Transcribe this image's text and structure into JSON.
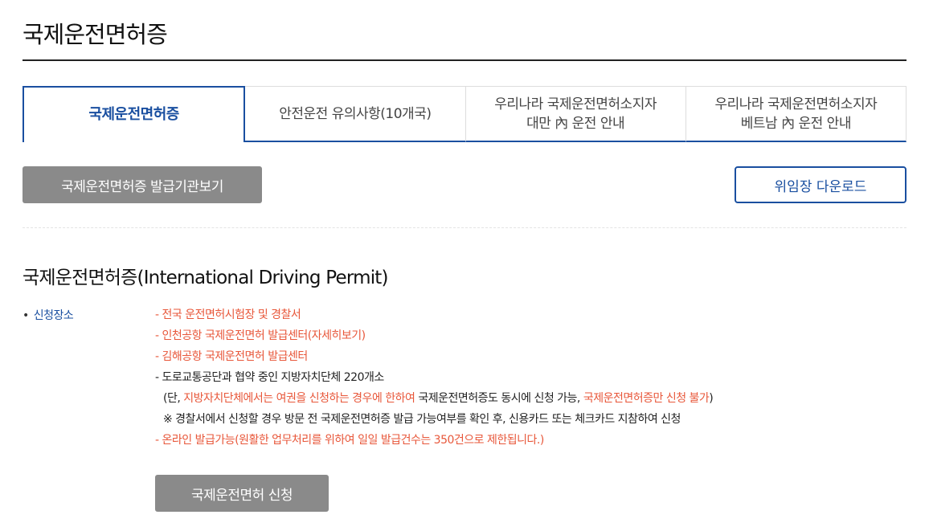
{
  "page": {
    "title": "국제운전면허증"
  },
  "tabs": [
    {
      "line1": "국제운전면허증",
      "line2": ""
    },
    {
      "line1": "안전운전 유의사항(10개국)",
      "line2": ""
    },
    {
      "line1": "우리나라 국제운전면허소지자",
      "line2": "대만 內 운전 안내"
    },
    {
      "line1": "우리나라 국제운전면허소지자",
      "line2": "베트남 內 운전 안내"
    }
  ],
  "actions": {
    "issuers_button": "국제운전면허증 발급기관보기",
    "proxy_download_button": "위임장 다운로드",
    "apply_button": "국제운전면허 신청"
  },
  "section": {
    "title": "국제운전면허증(International Driving Permit)",
    "label": "신청장소",
    "lines": {
      "l1": "- 전국 운전면허시험장 및 경찰서",
      "l2": "- 인천공항 국제운전면허 발급센터(자세히보기)",
      "l3": "- 김해공항 국제운전면허 발급센터",
      "l4": "- 도로교통공단과 협약 중인 지방자치단체 220개소",
      "l5_a": "(단, ",
      "l5_b": "지방자치단체에서는 여권을 신청하는 경우에 한하여",
      "l5_c": " 국제운전면허증도 동시에 신청 가능, ",
      "l5_d": "국제운전면허증만 신청 불가",
      "l5_e": ")",
      "l6": "※ 경찰서에서 신청할 경우 방문 전 국제운전면허증 발급 가능여부를 확인 후, 신용카드 또는 체크카드 지참하여 신청",
      "l7": "- 온라인 발급가능(원활한 업무처리를 위하여 일일 발급건수는 350건으로 제한됩니다.)"
    }
  },
  "colors": {
    "accent": "#1a4fa0",
    "highlight": "#e8573a",
    "button_gray": "#8a8a8a"
  }
}
